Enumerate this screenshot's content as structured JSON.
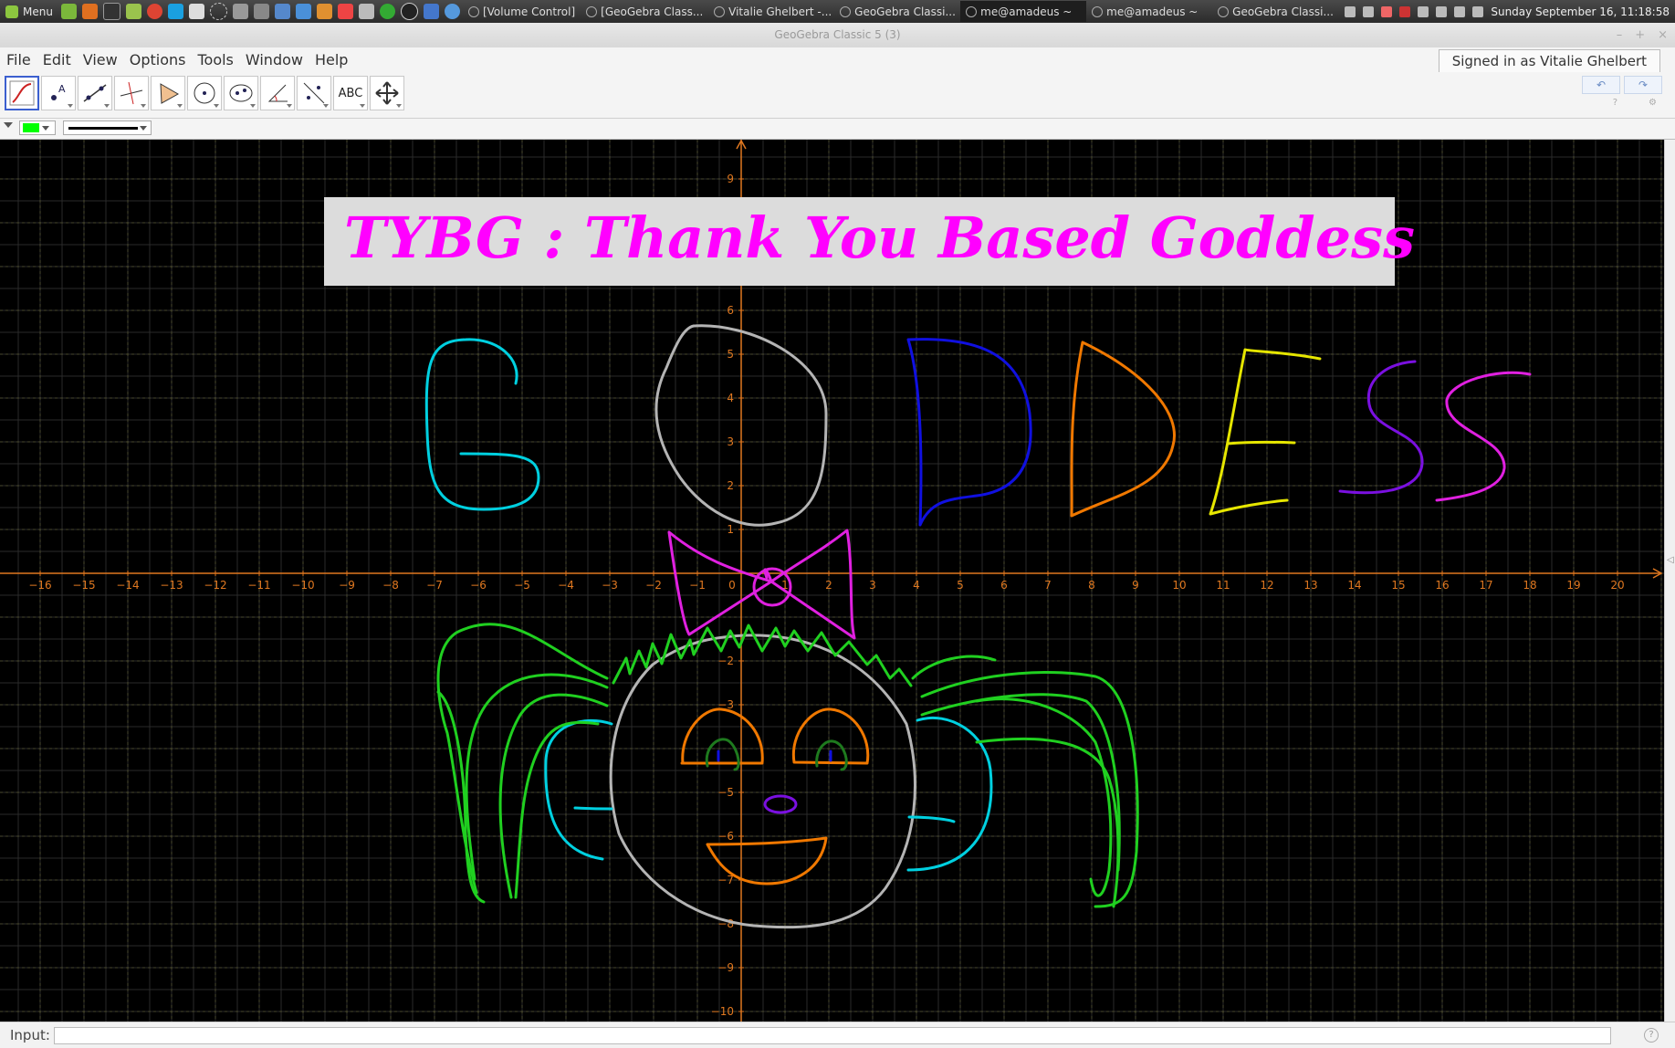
{
  "taskbar": {
    "menu_label": "Menu",
    "windows": [
      {
        "label": "[Volume Control]",
        "active": false
      },
      {
        "label": "[GeoGebra Class...",
        "active": false
      },
      {
        "label": "Vitalie Ghelbert -...",
        "active": false
      },
      {
        "label": "GeoGebra Classi...",
        "active": false
      },
      {
        "label": "me@amadeus ~",
        "active": true
      },
      {
        "label": "me@amadeus ~",
        "active": false
      },
      {
        "label": "GeoGebra Classi...",
        "active": false
      }
    ],
    "clock": "Sunday September 16, 11:18:58"
  },
  "window": {
    "title": "GeoGebra Classic 5 (3)",
    "controls": [
      "–",
      "+",
      "×"
    ]
  },
  "menubar": {
    "items": [
      "File",
      "Edit",
      "View",
      "Options",
      "Tools",
      "Window",
      "Help"
    ],
    "signed_in": "Signed in as Vitalie Ghelbert"
  },
  "toolbar": {
    "tools": [
      {
        "name": "freehand-tool",
        "active": true
      },
      {
        "name": "point-tool",
        "active": false
      },
      {
        "name": "line-tool",
        "active": false
      },
      {
        "name": "perpendicular-line-tool",
        "active": false
      },
      {
        "name": "polygon-tool",
        "active": false
      },
      {
        "name": "circle-tool",
        "active": false
      },
      {
        "name": "ellipse-tool",
        "active": false
      },
      {
        "name": "angle-tool",
        "active": false
      },
      {
        "name": "reflect-tool",
        "active": false
      },
      {
        "name": "text-tool",
        "active": false,
        "label": "ABC"
      },
      {
        "name": "move-graphics-view-tool",
        "active": false
      }
    ],
    "undo_icon": "undo-icon",
    "redo_icon": "redo-icon"
  },
  "stylebar": {
    "color": "#00ff00",
    "line_style": "solid"
  },
  "graphics": {
    "background": "#000000",
    "axis_color": "#e07820",
    "banner_text": "TYBG :  Thank You Based Goddess",
    "banner_color": "#ff00ff",
    "banner_bg": "#dcdcdc",
    "x_ticks": [
      -16,
      -15,
      -14,
      -13,
      -12,
      -11,
      -10,
      -9,
      -8,
      -7,
      -6,
      -5,
      -4,
      -3,
      -2,
      -1,
      0,
      1,
      2,
      3,
      4,
      5,
      6,
      7,
      8,
      9,
      10,
      11,
      12,
      13,
      14,
      15,
      16,
      17,
      18,
      19,
      20
    ],
    "y_ticks": [
      9,
      6,
      5,
      4,
      3,
      2,
      1,
      -2,
      -3,
      -5,
      -6,
      -7,
      -8,
      -9,
      -10
    ],
    "drawing_words": "GODDESS",
    "colors": {
      "cyan": "#00d0e0",
      "gray": "#b4b4b4",
      "blue": "#1010e0",
      "orange": "#f07800",
      "yellow": "#e6e600",
      "purple": "#7a10e0",
      "magenta": "#e020e0",
      "green": "#20d020"
    }
  },
  "inputbar": {
    "label": "Input:",
    "value": "",
    "help": "?"
  }
}
